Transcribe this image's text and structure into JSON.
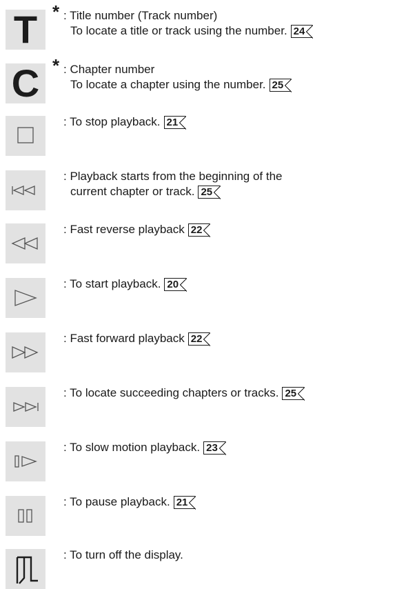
{
  "items": [
    {
      "icon": "title-letter-icon",
      "glyph": "T",
      "asterisk": "*",
      "line1": ": Title number (Track number)",
      "line2": "To locate a title or track using the number.",
      "ref": "24"
    },
    {
      "icon": "chapter-letter-icon",
      "glyph": "C",
      "asterisk": "*",
      "line1": ": Chapter number",
      "line2": "To locate a chapter using the number.",
      "ref": "25"
    },
    {
      "icon": "stop-icon",
      "line1": ": To stop playback.",
      "ref": "21"
    },
    {
      "icon": "skip-back-icon",
      "line1": ": Playback starts from the beginning of the",
      "line2": "current chapter or track.",
      "ref": "25"
    },
    {
      "icon": "fast-reverse-icon",
      "line1": ": Fast reverse playback",
      "ref": "22"
    },
    {
      "icon": "play-icon",
      "line1": ": To start playback.",
      "ref": "20"
    },
    {
      "icon": "fast-forward-icon",
      "line1": ": Fast forward playback",
      "ref": "22"
    },
    {
      "icon": "skip-forward-icon",
      "line1": ": To locate succeeding chapters or tracks.",
      "ref": "25"
    },
    {
      "icon": "slow-motion-icon",
      "line1": ": To slow motion playback.",
      "ref": "23"
    },
    {
      "icon": "pause-icon",
      "line1": ": To pause playback.",
      "ref": "21"
    },
    {
      "icon": "display-off-icon",
      "line1": ": To turn off the display."
    }
  ]
}
